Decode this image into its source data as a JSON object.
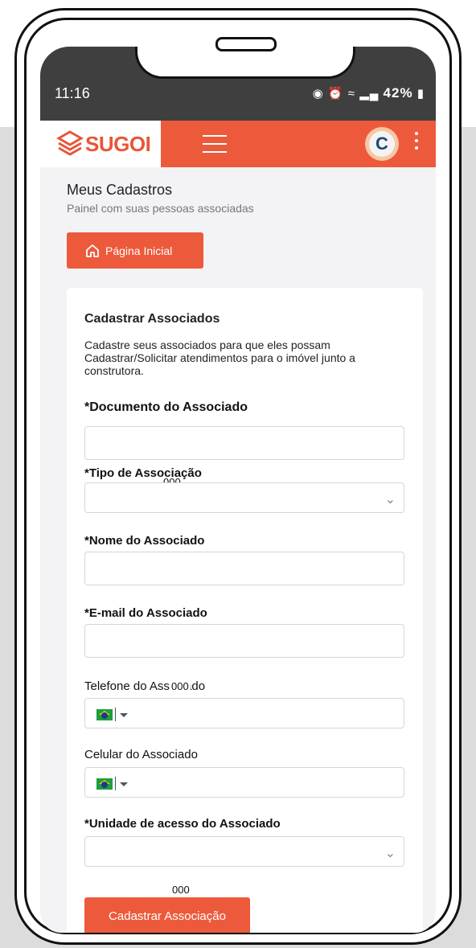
{
  "status_bar": {
    "time": "11:16",
    "battery": "42%"
  },
  "header": {
    "logo_text": "SUGOI",
    "avatar_letter": "C"
  },
  "page": {
    "title": "Meus Cadastros",
    "subtitle": "Painel com suas pessoas associadas",
    "home_button": "Página Inicial"
  },
  "form": {
    "title": "Cadastrar Associados",
    "description": "Cadastre seus associados para que eles possam Cadastrar/Solicitar atendimentos para o imóvel junto a construtora.",
    "fields": {
      "documento": "*Documento do Associado",
      "tipo": "*Tipo de Associação",
      "nome": "*Nome do Associado",
      "email": "*E-mail do Associado",
      "telefone": "Telefone do Associado",
      "celular": "Celular do Associado",
      "unidade": "*Unidade de acesso do Associado"
    },
    "submit": "Cadastrar Associação",
    "badge": "000"
  },
  "colors": {
    "accent": "#ec5a3b",
    "status_bar": "#3f3f3f"
  },
  "icons": [
    "home-icon",
    "menu-icon",
    "more-vert-icon",
    "chevron-down-icon",
    "brazil-flag-icon"
  ]
}
